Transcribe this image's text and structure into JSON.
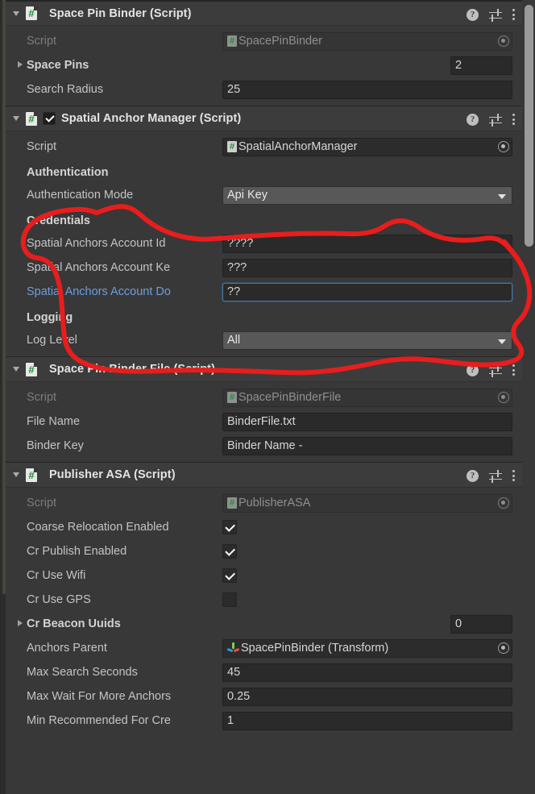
{
  "theme": {
    "panel_bg": "#383838",
    "header_bg": "#3c3c3c",
    "field_bg": "#2a2a2a",
    "dropdown_bg": "#585858",
    "label": "#c4c4c4",
    "label_dim": "#7c7c7c",
    "label_link": "#6c9ede",
    "focus_border": "#4477ab",
    "annotation": "#e81d1d",
    "script_icon_green": "#1f8f3c"
  },
  "icons": {
    "foldout_open": "chevron-down-icon",
    "foldout_closed": "chevron-right-icon",
    "script": "csharp-script-icon",
    "help": "help-icon",
    "preset": "preset-sliders-icon",
    "menu": "more-options-icon",
    "picker": "object-picker-icon",
    "transform": "transform-gizmo-icon",
    "dropdown": "chevron-down-icon"
  },
  "components": [
    {
      "name": "Space Pin Binder (Script)",
      "expanded": true,
      "has_enable_checkbox": false,
      "rows": [
        {
          "kind": "objref",
          "label": "Script",
          "label_style": "dim",
          "value": "SpacePinBinder",
          "icon": "csharp-script-icon",
          "disabled": true,
          "picker": true
        },
        {
          "kind": "arraysize",
          "label": "Space Pins",
          "label_style": "bold",
          "value": "2",
          "foldout": "chevron-right-icon"
        },
        {
          "kind": "text",
          "label": "Search Radius",
          "value": "25"
        }
      ]
    },
    {
      "name": "Spatial Anchor Manager (Script)",
      "expanded": true,
      "has_enable_checkbox": true,
      "enabled": true,
      "rows": [
        {
          "kind": "objref",
          "label": "Script",
          "value": "SpatialAnchorManager",
          "icon": "csharp-script-icon",
          "disabled": false,
          "picker": true
        },
        {
          "kind": "section",
          "label": "Authentication"
        },
        {
          "kind": "dropdown",
          "label": "Authentication Mode",
          "value": "Api Key"
        },
        {
          "kind": "section",
          "label": "Credentials"
        },
        {
          "kind": "text",
          "label": "Spatial Anchors Account Id",
          "value": "????"
        },
        {
          "kind": "text",
          "label": "Spatial Anchors Account Ke",
          "value": "???"
        },
        {
          "kind": "text",
          "label": "Spatial Anchors Account Do",
          "label_style": "linked",
          "value": "??",
          "focused": true
        },
        {
          "kind": "section",
          "label": "Logging"
        },
        {
          "kind": "dropdown",
          "label": "Log Level",
          "value": "All"
        }
      ]
    },
    {
      "name": "Space Pin Binder File (Script)",
      "expanded": true,
      "has_enable_checkbox": false,
      "rows": [
        {
          "kind": "objref",
          "label": "Script",
          "label_style": "dim",
          "value": "SpacePinBinderFile",
          "icon": "csharp-script-icon",
          "disabled": true,
          "picker": true
        },
        {
          "kind": "text",
          "label": "File Name",
          "value": "BinderFile.txt"
        },
        {
          "kind": "text",
          "label": "Binder Key",
          "value": "Binder Name -"
        }
      ]
    },
    {
      "name": "Publisher ASA (Script)",
      "expanded": true,
      "has_enable_checkbox": false,
      "rows": [
        {
          "kind": "objref",
          "label": "Script",
          "label_style": "dim",
          "value": "PublisherASA",
          "icon": "csharp-script-icon",
          "disabled": true,
          "picker": true
        },
        {
          "kind": "checkbox",
          "label": "Coarse Relocation Enabled",
          "checked": true
        },
        {
          "kind": "checkbox",
          "label": "Cr Publish Enabled",
          "checked": true
        },
        {
          "kind": "checkbox",
          "label": "Cr Use Wifi",
          "checked": true
        },
        {
          "kind": "checkbox",
          "label": "Cr Use GPS",
          "checked": false
        },
        {
          "kind": "arraysize",
          "label": "Cr Beacon Uuids",
          "label_style": "bold",
          "value": "0",
          "foldout": "chevron-right-icon"
        },
        {
          "kind": "objref",
          "label": "Anchors Parent",
          "value": "SpacePinBinder (Transform)",
          "icon": "transform-gizmo-icon",
          "disabled": false,
          "picker": true
        },
        {
          "kind": "text",
          "label": "Max Search Seconds",
          "value": "45"
        },
        {
          "kind": "text",
          "label": "Max Wait For More Anchors",
          "value": "0.25"
        },
        {
          "kind": "text",
          "label": "Min Recommended For Cre",
          "value": "1"
        }
      ]
    }
  ],
  "annotation": {
    "shape": "freehand-ellipse-loop",
    "color": "#e81d1d",
    "encircles": "Credentials fields of Spatial Anchor Manager"
  },
  "scrollbar": {
    "visible": true,
    "position": "right"
  }
}
